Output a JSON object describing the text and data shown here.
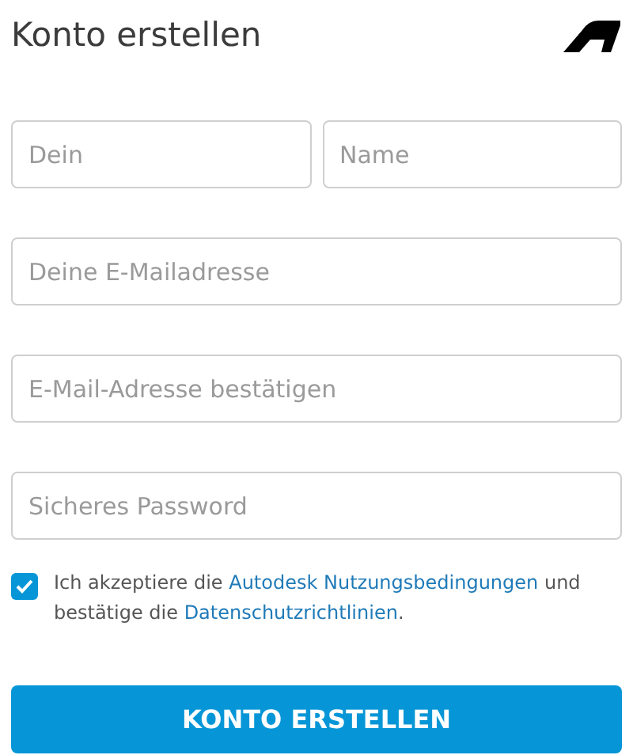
{
  "title": "Konto erstellen",
  "name_fields": [
    {
      "placeholder": "Dein"
    },
    {
      "placeholder": "Name"
    }
  ],
  "fields": [
    {
      "placeholder": "Deine E-Mailadresse"
    },
    {
      "placeholder": "E-Mail-Adresse bestätigen"
    },
    {
      "placeholder": "Sicheres Password"
    }
  ],
  "consent": {
    "checked": true,
    "parts": [
      {
        "kind": "text",
        "text": "Ich akzeptiere die "
      },
      {
        "kind": "link",
        "text": "Autodesk Nutzungsbedingungen"
      },
      {
        "kind": "text",
        "text": " und bestätige die "
      },
      {
        "kind": "link",
        "text": "Datenschutzrichtlinien"
      },
      {
        "kind": "text",
        "text": "."
      }
    ]
  },
  "submit": "KONTO ERSTELLEN"
}
